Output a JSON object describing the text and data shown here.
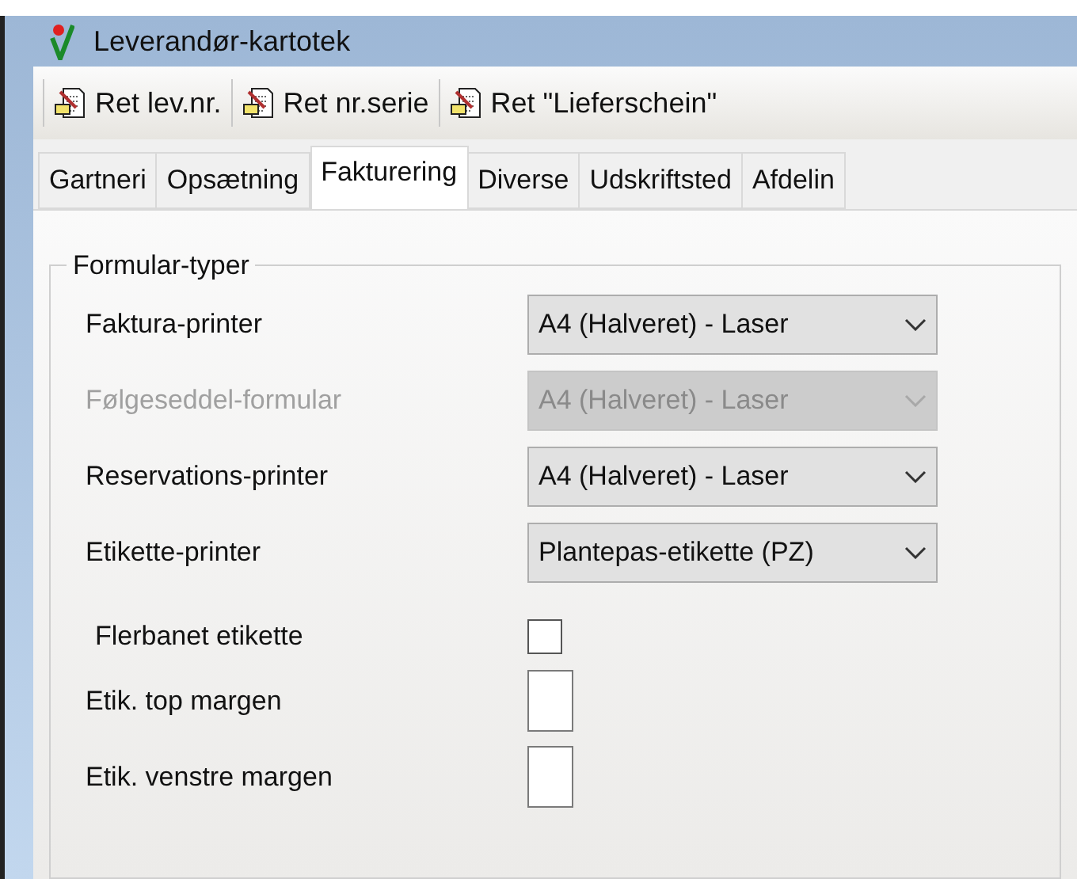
{
  "window": {
    "title": "Leverandør-kartotek"
  },
  "toolbar": [
    {
      "label": "Ret lev.nr."
    },
    {
      "label": "Ret nr.serie"
    },
    {
      "label": "Ret \"Lieferschein\""
    }
  ],
  "tabs": [
    {
      "label": "Gartneri",
      "selected": false
    },
    {
      "label": "Opsætning",
      "selected": false
    },
    {
      "label": "Fakturering",
      "selected": true
    },
    {
      "label": "Diverse",
      "selected": false
    },
    {
      "label": "Udskriftsted",
      "selected": false
    },
    {
      "label": "Afdelin",
      "selected": false
    }
  ],
  "group": {
    "title": "Formular-typer",
    "rows": [
      {
        "kind": "combo",
        "label": "Faktura-printer",
        "value": "A4 (Halveret) - Laser",
        "disabled": false
      },
      {
        "kind": "combo",
        "label": "Følgeseddel-formular",
        "value": "A4 (Halveret) - Laser",
        "disabled": true
      },
      {
        "kind": "combo",
        "label": "Reservations-printer",
        "value": "A4 (Halveret) - Laser",
        "disabled": false
      },
      {
        "kind": "combo",
        "label": "Etikette-printer",
        "value": "Plantepas-etikette (PZ)",
        "disabled": false
      },
      {
        "kind": "checkbox",
        "label": "Flerbanet etikette",
        "checked": false
      },
      {
        "kind": "text",
        "label": "Etik. top margen"
      },
      {
        "kind": "text",
        "label": "Etik. venstre margen"
      }
    ]
  }
}
